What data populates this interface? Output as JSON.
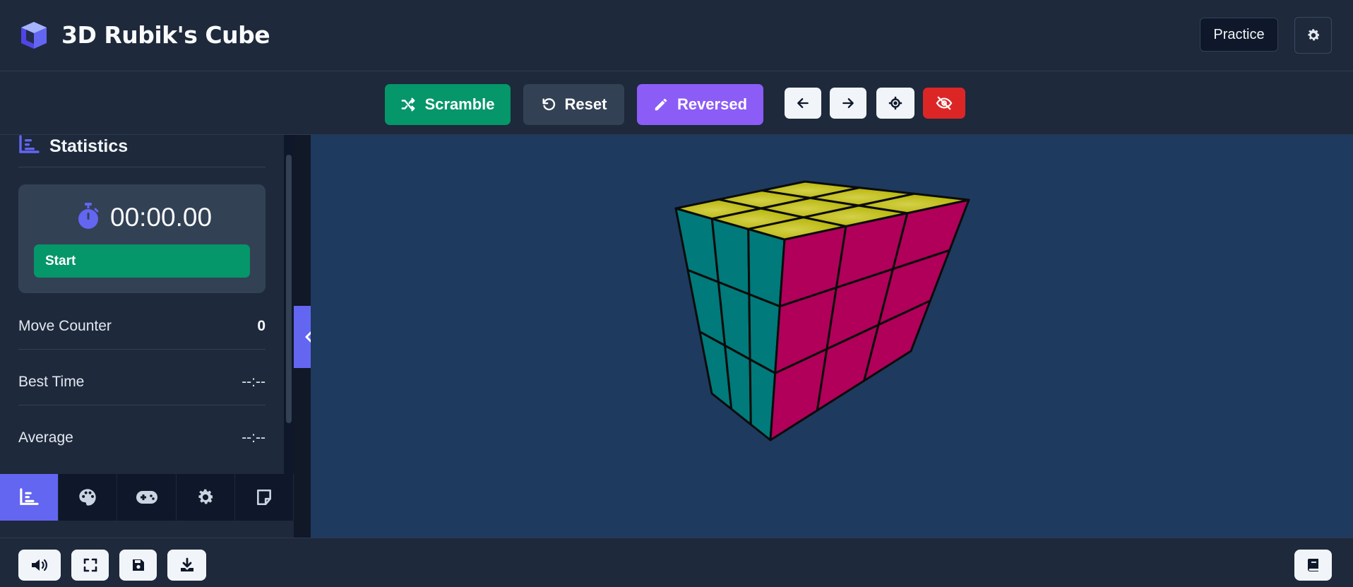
{
  "header": {
    "title": "3D Rubik's Cube",
    "practice_label": "Practice",
    "logo_icon": "cube-icon",
    "settings_icon": "gear-icon"
  },
  "toolbar": {
    "scramble_label": "Scramble",
    "reset_label": "Reset",
    "reversed_label": "Reversed",
    "icons": [
      "arrow-left-icon",
      "arrow-right-icon",
      "crosshair-icon",
      "eye-slash-icon"
    ]
  },
  "stats": {
    "title": "Statistics",
    "timer": "00:00.00",
    "start_label": "Start",
    "rows": [
      {
        "label": "Move Counter",
        "value": "0"
      },
      {
        "label": "Best Time",
        "value": "--:--"
      },
      {
        "label": "Average",
        "value": "--:--"
      }
    ]
  },
  "tabs": [
    "chart-icon",
    "palette-icon",
    "gamepad-icon",
    "gear-icon",
    "note-icon"
  ],
  "footer": {
    "icons": [
      "volume-icon",
      "fullscreen-icon",
      "save-icon",
      "download-icon",
      "book-icon"
    ]
  },
  "colors": {
    "accent": "#6366f1",
    "green": "#059669",
    "purple": "#8b5cf6",
    "red": "#dc2626",
    "viewport_bg": "#1e3a5f",
    "cube_top": "#bcbc00",
    "cube_left": "#007a7a",
    "cube_right": "#b0005a"
  }
}
